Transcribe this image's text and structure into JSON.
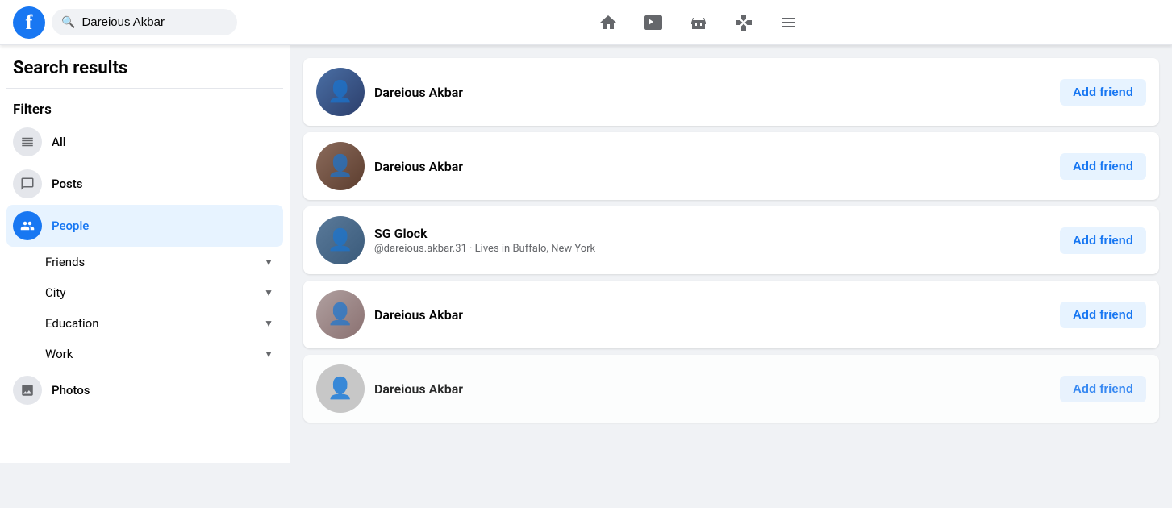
{
  "topnav": {
    "logo": "f",
    "search_value": "Dareious Akbar",
    "search_placeholder": "Dareious Akbar",
    "nav_icons": [
      {
        "name": "home-icon",
        "symbol": "⌂"
      },
      {
        "name": "video-icon",
        "symbol": "▶"
      },
      {
        "name": "marketplace-icon",
        "symbol": "🏪"
      },
      {
        "name": "gaming-icon",
        "symbol": "🎮"
      },
      {
        "name": "menu-icon",
        "symbol": "⊞"
      }
    ]
  },
  "sidebar": {
    "title": "Search results",
    "filters_label": "Filters",
    "filter_items": [
      {
        "id": "all",
        "label": "All",
        "icon": "📋",
        "active": false
      },
      {
        "id": "posts",
        "label": "Posts",
        "icon": "💬",
        "active": false
      },
      {
        "id": "people",
        "label": "People",
        "icon": "👥",
        "active": true
      }
    ],
    "sub_filters": [
      {
        "label": "Friends"
      },
      {
        "label": "City"
      },
      {
        "label": "Education"
      },
      {
        "label": "Work"
      }
    ],
    "more_filters": [
      {
        "id": "photos",
        "label": "Photos",
        "icon": "🖼️"
      }
    ]
  },
  "results": [
    {
      "name": "Dareious Akbar",
      "sub": "",
      "btn": "Add friend",
      "av_class": "av1"
    },
    {
      "name": "Dareious Akbar",
      "sub": "",
      "btn": "Add friend",
      "av_class": "av2"
    },
    {
      "name": "SG Glock",
      "sub": "@dareious.akbar.31 · Lives in Buffalo, New York",
      "btn": "Add friend",
      "av_class": "av3"
    },
    {
      "name": "Dareious Akbar",
      "sub": "",
      "btn": "Add friend",
      "av_class": "av4"
    },
    {
      "name": "Dareious Akbar",
      "sub": "",
      "btn": "Add friend",
      "av_class": "av5"
    }
  ]
}
